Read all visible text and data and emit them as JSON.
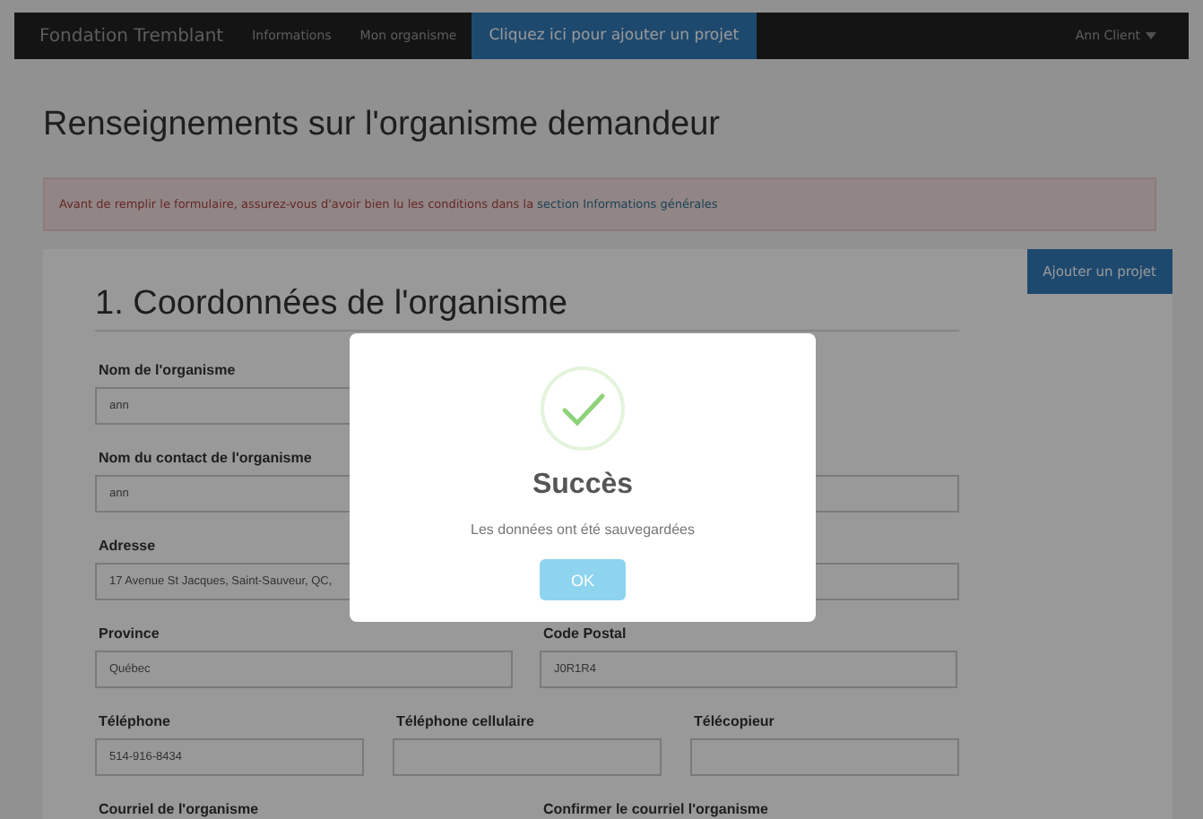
{
  "navbar": {
    "brand": "Fondation Tremblant",
    "links": [
      {
        "label": "Informations",
        "selected": false
      },
      {
        "label": "Mon organisme",
        "selected": false
      },
      {
        "label": "Cliquez ici pour ajouter un projet",
        "selected": true
      }
    ],
    "user_menu": "Ann Client"
  },
  "page_title": "Renseignements sur l'organisme demandeur",
  "alert": {
    "text": "Avant de remplir le formulaire, assurez-vous d'avoir bien lu les conditions dans la",
    "link": "section Informations générales"
  },
  "add_button": "Ajouter un projet",
  "section_title": "1. Coordonnées de l'organisme",
  "rows": [
    [
      {
        "label": "Nom de l'organisme",
        "value": "ann",
        "kind": "half"
      }
    ],
    [
      {
        "label": "Nom du contact de l'organisme",
        "value": "ann",
        "kind": "full"
      }
    ],
    [
      {
        "label": "Adresse",
        "value": "17 Avenue St Jacques, Saint-Sauveur, QC,",
        "kind": "full"
      }
    ],
    [
      {
        "label": "Province",
        "value": "Québec",
        "kind": "half"
      },
      {
        "label": "Code Postal",
        "value": "J0R1R4",
        "kind": "half"
      }
    ],
    [
      {
        "label": "Téléphone",
        "value": "514-916-8434",
        "kind": "third"
      },
      {
        "label": "Téléphone cellulaire",
        "kind": "third"
      },
      {
        "label": "Télécopieur",
        "kind": "third"
      }
    ],
    [
      {
        "label": "Courriel de l'organisme",
        "kind": "label_only"
      },
      {
        "label": "Confirmer le courriel l'organisme",
        "kind": "label_only"
      }
    ]
  ],
  "modal": {
    "title": "Succès",
    "message": "Les données ont été sauvegardées",
    "button": "OK"
  }
}
